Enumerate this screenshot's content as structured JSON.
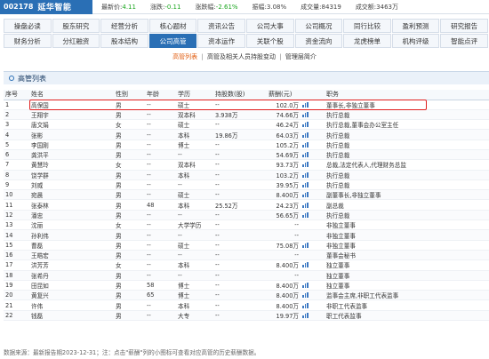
{
  "stock": {
    "code": "002178",
    "name": "延华智能",
    "latest_label": "最新价:",
    "latest": "4.11",
    "change_label": "涨跌:",
    "change": "-0.11",
    "change_pct_label": "涨跌幅:",
    "change_pct": "-2.61%",
    "amplitude_label": "振幅:",
    "amplitude": "3.08%",
    "volume_label": "成交量:",
    "volume": "84319",
    "turnover_label": "成交额:",
    "turnover": "3463万"
  },
  "nav_row1": [
    "操盘必读",
    "股东研究",
    "经营分析",
    "核心题材",
    "资讯公告",
    "公司大事",
    "公司概况",
    "同行比较",
    "盈利预测",
    "研究报告"
  ],
  "nav_row2": [
    "财务分析",
    "分红融资",
    "股本结构",
    "公司高管",
    "资本运作",
    "关联个股",
    "资金流向",
    "龙虎榜单",
    "机构评级",
    "智能点评"
  ],
  "nav_row2_active_index": 3,
  "subtabs": {
    "t1": "高管列表",
    "sep1": "|",
    "t2": "高管及相关人员持股变动",
    "sep2": "|",
    "t3": "管理层简介"
  },
  "section_title": "高管列表",
  "table": {
    "headers": [
      "序号",
      "姓名",
      "性别",
      "年龄",
      "学历",
      "持股数(股)",
      "薪酬(元)",
      "职务"
    ],
    "rows": [
      [
        "1",
        "高保国",
        "男",
        "--",
        "硕士",
        "--",
        "102.0万",
        "董事长,非独立董事"
      ],
      [
        "2",
        "王翔宇",
        "男",
        "--",
        "双本科",
        "3.938万",
        "74.66万",
        "执行总裁"
      ],
      [
        "3",
        "唐文娟",
        "女",
        "--",
        "硕士",
        "--",
        "46.24万",
        "执行总裁,董事会办公室主任"
      ],
      [
        "4",
        "张彬",
        "男",
        "--",
        "本科",
        "19.86万",
        "64.03万",
        "执行总裁"
      ],
      [
        "5",
        "李国刚",
        "男",
        "--",
        "博士",
        "--",
        "105.2万",
        "执行总裁"
      ],
      [
        "6",
        "龚洪平",
        "男",
        "--",
        "--",
        "--",
        "54.69万",
        "执行总裁"
      ],
      [
        "7",
        "黄慧玲",
        "女",
        "--",
        "双本科",
        "--",
        "93.73万",
        "总裁,法定代表人,代理财务总监"
      ],
      [
        "8",
        "饶学群",
        "男",
        "--",
        "本科",
        "--",
        "103.2万",
        "执行总裁"
      ],
      [
        "9",
        "刘威",
        "男",
        "--",
        "--",
        "--",
        "39.95万",
        "执行总裁"
      ],
      [
        "10",
        "宛晨",
        "男",
        "--",
        "硕士",
        "--",
        "8.400万",
        "副董事长,非独立董事"
      ],
      [
        "11",
        "张泰林",
        "男",
        "48",
        "本科",
        "25.52万",
        "24.23万",
        "副总裁"
      ],
      [
        "12",
        "潘忠",
        "男",
        "--",
        "--",
        "--",
        "56.65万",
        "执行总裁"
      ],
      [
        "13",
        "沈丽",
        "女",
        "--",
        "大学学历",
        "--",
        "--",
        "非独立董事"
      ],
      [
        "14",
        "孙利伟",
        "男",
        "--",
        "--",
        "--",
        "--",
        "非独立董事"
      ],
      [
        "15",
        "曹磊",
        "男",
        "--",
        "硕士",
        "--",
        "75.08万",
        "非独立董事"
      ],
      [
        "16",
        "王皓宏",
        "男",
        "--",
        "--",
        "--",
        "--",
        "董事会秘书"
      ],
      [
        "17",
        "洪芳芳",
        "女",
        "--",
        "本科",
        "--",
        "8.400万",
        "独立董事"
      ],
      [
        "18",
        "张希丹",
        "男",
        "--",
        "--",
        "--",
        "--",
        "独立董事"
      ],
      [
        "19",
        "田昆如",
        "男",
        "58",
        "博士",
        "--",
        "8.400万",
        "独立董事"
      ],
      [
        "20",
        "黄复兴",
        "男",
        "65",
        "博士",
        "--",
        "8.400万",
        "监事会主席,非职工代表监事"
      ],
      [
        "21",
        "许伟",
        "男",
        "--",
        "本科",
        "--",
        "8.400万",
        "非职工代表监事"
      ],
      [
        "22",
        "钱磊",
        "男",
        "--",
        "大专",
        "--",
        "19.97万",
        "职工代表监事"
      ]
    ],
    "highlight_row": 0
  },
  "footer": "数据来源：最新报告期2023-12-31；注：点击\"薪酬\"列的小图标可查看对应高管的历史薪酬数据。",
  "colors": {
    "brand": "#2a6fb5",
    "subtab_selected": "#e15c0f",
    "highlight": "#e02020",
    "down": "#19a51d"
  },
  "icons": {
    "salary_chart": "bar-chart-icon",
    "section_bullet": "circle-bullet-icon"
  }
}
